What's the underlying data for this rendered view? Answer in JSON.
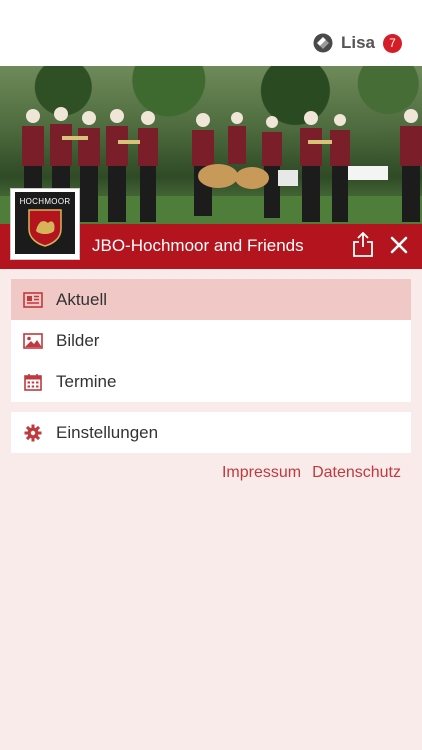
{
  "header": {
    "user_name": "Lisa",
    "notification_count": "7",
    "badge_color": "#d51d27"
  },
  "banner": {
    "crest_text": "HOCHMOOR",
    "title": "JBO-Hochmoor and Friends",
    "bar_color": "#b3141d"
  },
  "menu": {
    "items": [
      {
        "label": "Aktuell",
        "icon": "newspaper-icon",
        "active": true
      },
      {
        "label": "Bilder",
        "icon": "image-icon",
        "active": false
      },
      {
        "label": "Termine",
        "icon": "calendar-icon",
        "active": false
      }
    ],
    "settings_label": "Einstellungen",
    "settings_icon": "gear-icon"
  },
  "footer": {
    "impressum": "Impressum",
    "datenschutz": "Datenschutz",
    "link_color": "#c0393f"
  },
  "theme": {
    "background": "#f8ebea",
    "active_item": "#f0c9c7"
  }
}
